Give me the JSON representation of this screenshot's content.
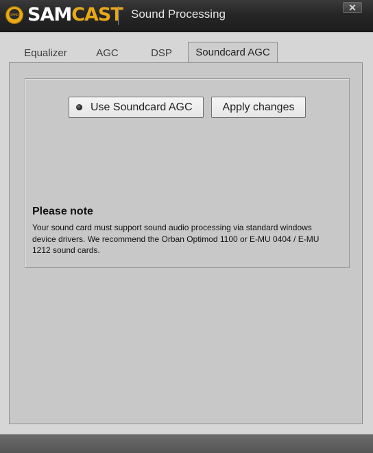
{
  "app": {
    "logo_text_primary": "SAM",
    "logo_text_accent": "CAST",
    "logo_badge": "SAMCAST",
    "window_title": "Sound Processing"
  },
  "tabs": [
    {
      "label": "Equalizer",
      "active": false
    },
    {
      "label": "AGC",
      "active": false
    },
    {
      "label": "DSP",
      "active": false
    },
    {
      "label": "Soundcard AGC",
      "active": true
    }
  ],
  "controls": {
    "use_soundcard_agc_label": "Use Soundcard AGC",
    "use_soundcard_agc_checked": true,
    "apply_changes_label": "Apply changes"
  },
  "note": {
    "title": "Please note",
    "body": "Your sound card must support sound audio processing via standard windows device drivers. We recommend the Orban Optimod 1100 or E-MU 0404 / E-MU 1212 sound cards."
  },
  "colors": {
    "accent": "#e8a818",
    "titlebar": "#262626",
    "panel": "#c8c8c8"
  }
}
